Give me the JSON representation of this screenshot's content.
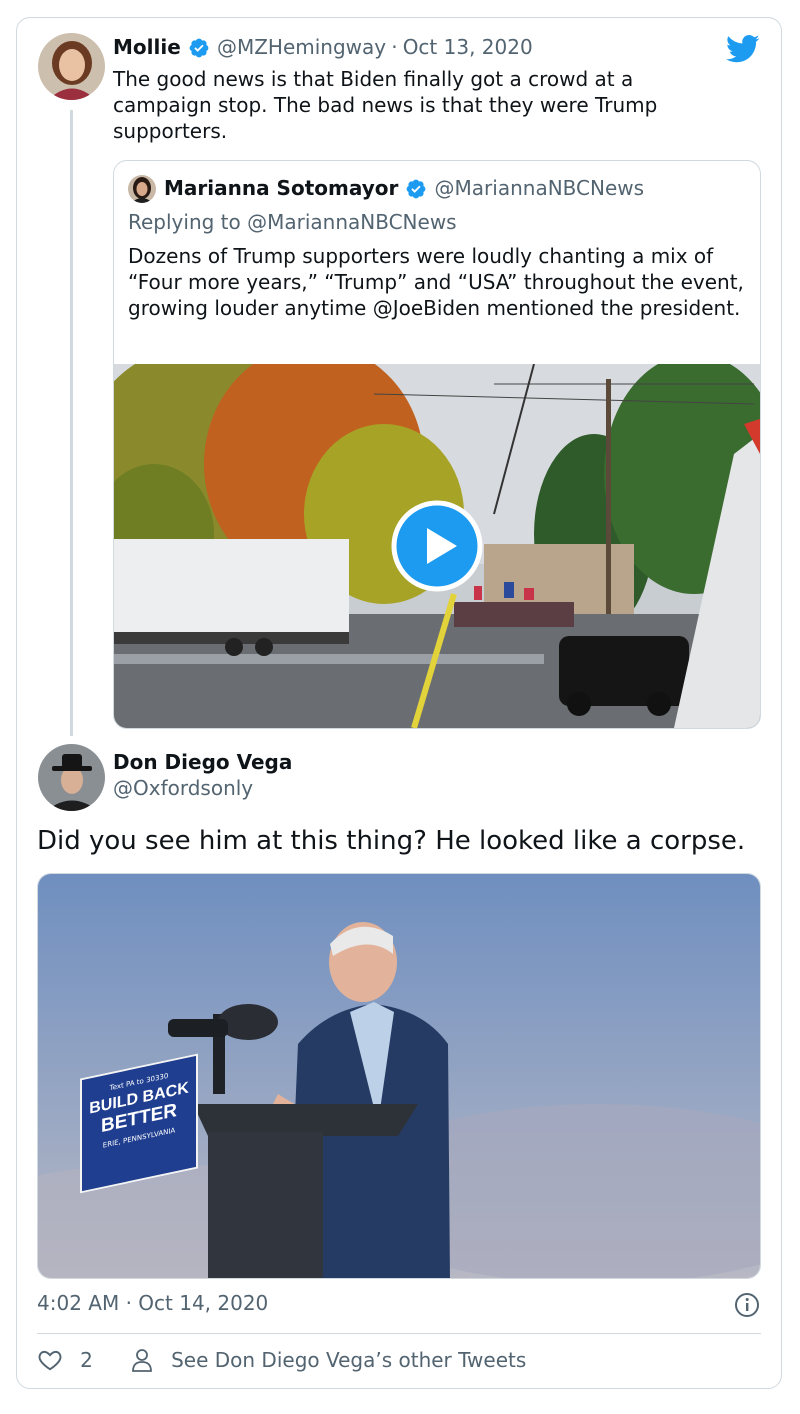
{
  "parent_tweet": {
    "name": "Mollie",
    "handle": "@MZHemingway",
    "separator": "·",
    "date": "Oct 13, 2020",
    "text": "The good news is that Biden finally got a crowd at a campaign stop. The bad news is that they were Trump supporters."
  },
  "quoted_tweet": {
    "name": "Marianna Sotomayor",
    "handle": "@MariannaNBCNews",
    "replying_to": "Replying to @MariannaNBCNews",
    "text": "Dozens of Trump supporters were loudly chanting a mix of “Four more years,” “Trump” and “USA” throughout the event, growing louder anytime @JoeBiden mentioned the president."
  },
  "main_tweet": {
    "name": "Don Diego Vega",
    "handle": "@Oxfordsonly",
    "text": "Did you see him at this thing? He looked like a corpse.",
    "timestamp": "4:02 AM · Oct 14, 2020",
    "podium_sign": {
      "small_top": "Text PA to 30330",
      "line1": "BUILD BACK",
      "line2": "BETTER",
      "line3": "ERIE, PENNSYLVANIA"
    }
  },
  "actions": {
    "like_count": "2",
    "see_other": "See Don Diego Vega’s other Tweets"
  },
  "colors": {
    "brand_blue": "#1d9bf0",
    "muted": "#536471",
    "border": "#cfd9de"
  },
  "icons": [
    "twitter-bird-icon",
    "verified-badge-icon",
    "play-icon",
    "info-icon",
    "heart-icon",
    "person-icon"
  ]
}
